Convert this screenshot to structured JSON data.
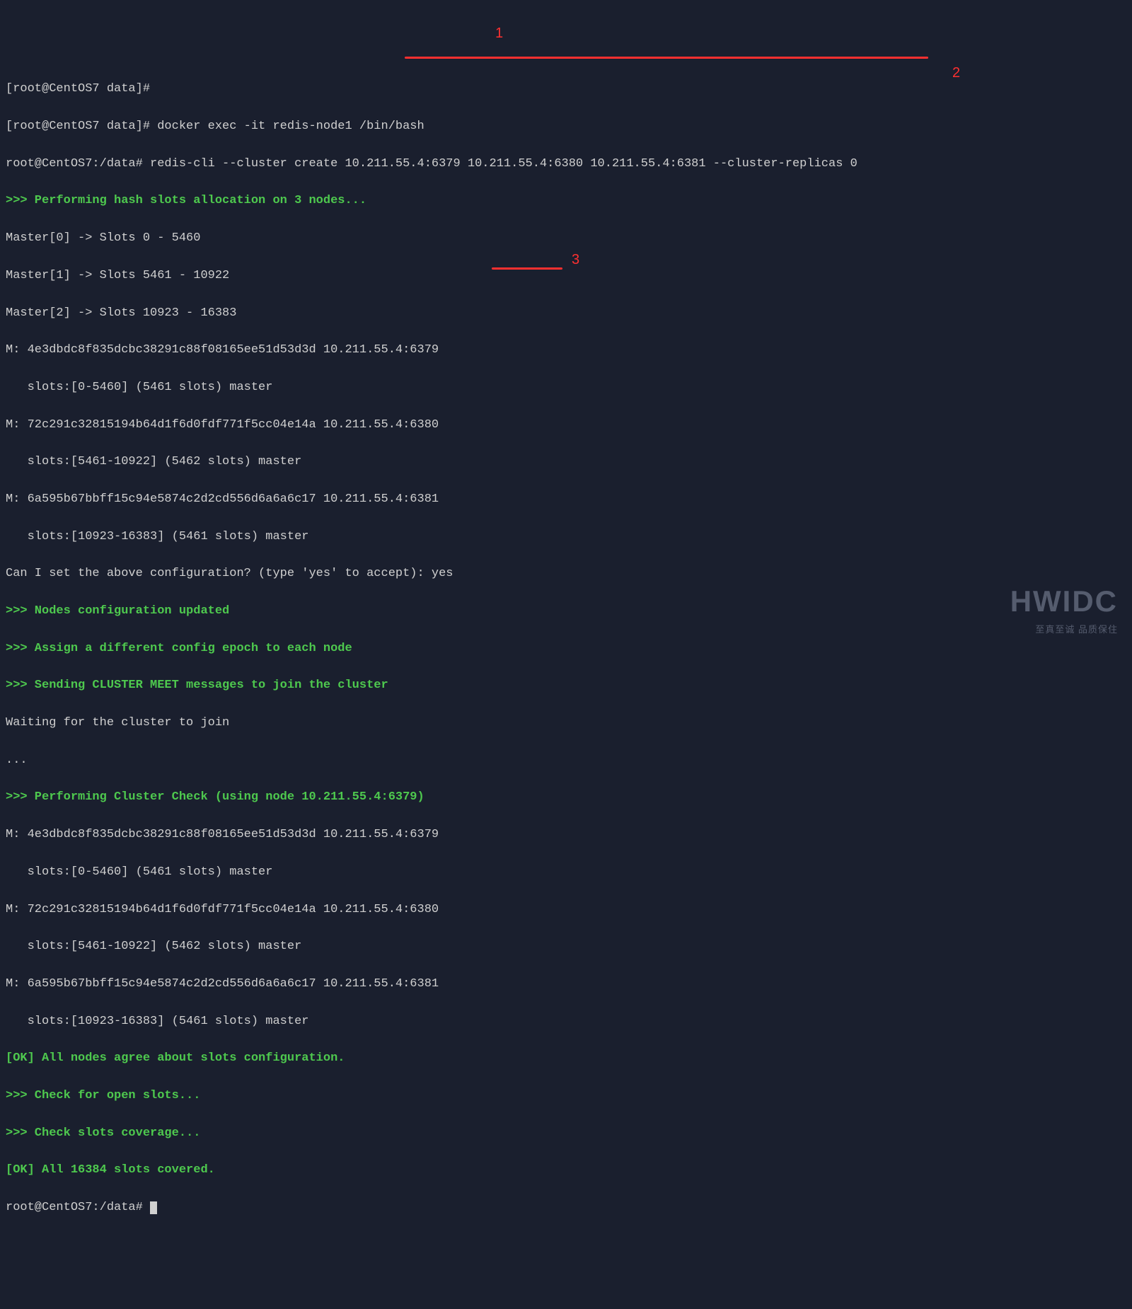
{
  "lines": {
    "l01": "[root@CentOS7 data]#",
    "l02": "[root@CentOS7 data]# docker exec -it redis-node1 /bin/bash",
    "l03": "root@CentOS7:/data# redis-cli --cluster create 10.211.55.4:6379 10.211.55.4:6380 10.211.55.4:6381 --cluster-replicas 0",
    "l04": ">>> Performing hash slots allocation on 3 nodes...",
    "l05": "Master[0] -> Slots 0 - 5460",
    "l06": "Master[1] -> Slots 5461 - 10922",
    "l07": "Master[2] -> Slots 10923 - 16383",
    "l08": "M: 4e3dbdc8f835dcbc38291c88f08165ee51d53d3d 10.211.55.4:6379",
    "l09": "   slots:[0-5460] (5461 slots) master",
    "l10": "M: 72c291c32815194b64d1f6d0fdf771f5cc04e14a 10.211.55.4:6380",
    "l11": "   slots:[5461-10922] (5462 slots) master",
    "l12": "M: 6a595b67bbff15c94e5874c2d2cd556d6a6a6c17 10.211.55.4:6381",
    "l13": "   slots:[10923-16383] (5461 slots) master",
    "l14": "Can I set the above configuration? (type 'yes' to accept): yes",
    "l15": ">>> Nodes configuration updated",
    "l16": ">>> Assign a different config epoch to each node",
    "l17": ">>> Sending CLUSTER MEET messages to join the cluster",
    "l18": "Waiting for the cluster to join",
    "l19": "...",
    "l20": ">>> Performing Cluster Check (using node 10.211.55.4:6379)",
    "l21": "M: 4e3dbdc8f835dcbc38291c88f08165ee51d53d3d 10.211.55.4:6379",
    "l22": "   slots:[0-5460] (5461 slots) master",
    "l23": "M: 72c291c32815194b64d1f6d0fdf771f5cc04e14a 10.211.55.4:6380",
    "l24": "   slots:[5461-10922] (5462 slots) master",
    "l25": "M: 6a595b67bbff15c94e5874c2d2cd556d6a6a6c17 10.211.55.4:6381",
    "l26": "   slots:[10923-16383] (5461 slots) master",
    "l27": "[OK] All nodes agree about slots configuration.",
    "l28": ">>> Check for open slots...",
    "l29": ">>> Check slots coverage...",
    "l30": "[OK] All 16384 slots covered.",
    "l31": "root@CentOS7:/data# "
  },
  "annotations": {
    "a1": "1",
    "a2": "2",
    "a3": "3"
  },
  "watermark": {
    "main": "HWIDC",
    "sub": "至真至诚 品质保住"
  }
}
